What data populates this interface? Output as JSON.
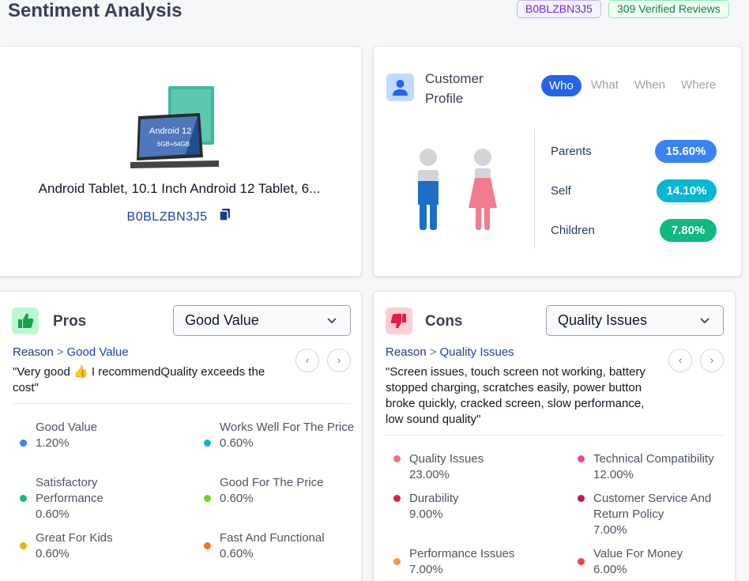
{
  "header": {
    "title": "Sentiment Analysis",
    "asin_badge": "B0BLZBN3J5",
    "reviews_badge": "309 Verified Reviews"
  },
  "product": {
    "name": "Android Tablet, 10.1 Inch Android 12 Tablet, 6...",
    "asin": "B0BLZBN3J5",
    "image_text_1": "Android 12",
    "image_text_2": "6GB+64GB"
  },
  "profile": {
    "title": "Customer Profile",
    "tabs": [
      "Who",
      "What",
      "When",
      "Where"
    ],
    "active_tab": "Who",
    "segments": [
      {
        "label": "Parents",
        "value": "15.60%",
        "color": "#3b82f6"
      },
      {
        "label": "Self",
        "value": "14.10%",
        "color": "#06b6d4"
      },
      {
        "label": "Children",
        "value": "7.80%",
        "color": "#10b981"
      }
    ]
  },
  "pros": {
    "title": "Pros",
    "selected": "Good Value",
    "reason_label": "Reason",
    "reason_value": "Good Value",
    "quote": "\"Very good 👍 I recommendQuality exceeds the cost\"",
    "items": [
      {
        "label": "Good Value",
        "value": "1.20%",
        "color": "#3b82f6"
      },
      {
        "label": "Works Well For The Price",
        "value": "0.60%",
        "color": "#06b6d4"
      },
      {
        "label": "Satisfactory Performance",
        "value": "0.60%",
        "color": "#10b981"
      },
      {
        "label": "Good For The Price",
        "value": "0.60%",
        "color": "#84cc16"
      },
      {
        "label": "Great For Kids",
        "value": "0.60%",
        "color": "#eab308"
      },
      {
        "label": "Fast And Functional",
        "value": "0.60%",
        "color": "#f97316"
      }
    ]
  },
  "cons": {
    "title": "Cons",
    "selected": "Quality Issues",
    "reason_label": "Reason",
    "reason_value": "Quality Issues",
    "quote": "\"Screen issues, touch screen not working, battery stopped charging, scratches easily, power button broke quickly, cracked screen, slow performance, low sound quality\"",
    "items": [
      {
        "label": "Quality Issues",
        "value": "23.00%",
        "color": "#f87171"
      },
      {
        "label": "Technical Compatibility",
        "value": "12.00%",
        "color": "#ec4899"
      },
      {
        "label": "Durability",
        "value": "9.00%",
        "color": "#e11d48"
      },
      {
        "label": "Customer Service And Return Policy",
        "value": "7.00%",
        "color": "#be185d"
      },
      {
        "label": "Performance Issues",
        "value": "7.00%",
        "color": "#fb923c"
      },
      {
        "label": "Value For Money",
        "value": "6.00%",
        "color": "#ef4444"
      }
    ]
  }
}
